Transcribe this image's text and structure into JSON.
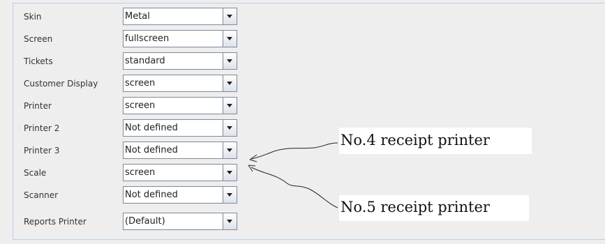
{
  "rows": [
    {
      "label": "Skin",
      "value": "Metal"
    },
    {
      "label": "Screen",
      "value": "fullscreen"
    },
    {
      "label": "Tickets",
      "value": "standard"
    },
    {
      "label": "Customer Display",
      "value": "screen"
    },
    {
      "label": "Printer",
      "value": "screen"
    },
    {
      "label": "Printer 2",
      "value": "Not defined"
    },
    {
      "label": "Printer 3",
      "value": "Not defined"
    },
    {
      "label": "Scale",
      "value": "screen"
    },
    {
      "label": "Scanner",
      "value": "Not defined"
    },
    {
      "label": "Reports Printer",
      "value": "(Default)"
    }
  ],
  "annotations": {
    "note1": "No.4 receipt printer",
    "note2": "No.5 receipt printer"
  }
}
